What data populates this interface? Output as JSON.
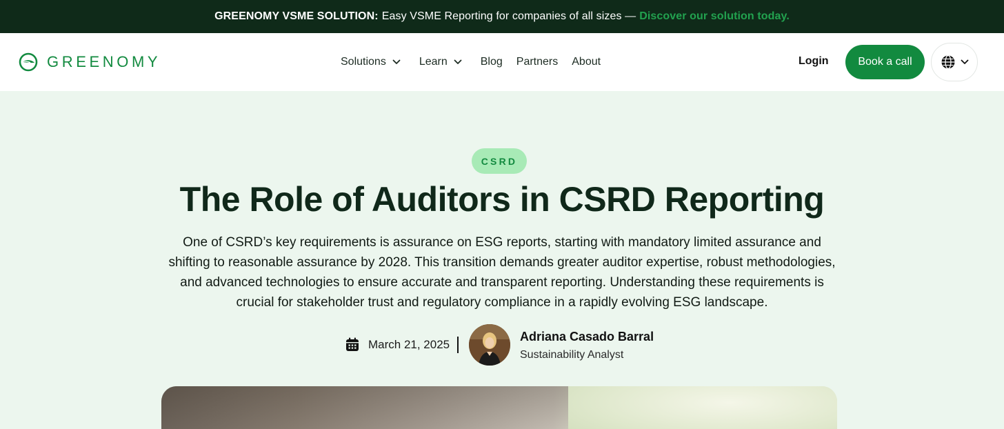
{
  "announcement": {
    "label": "GREENOMY VSME SOLUTION:",
    "message": "Easy VSME Reporting for companies of all sizes —",
    "cta": "Discover our solution today."
  },
  "nav": {
    "brand": "GREENOMY",
    "links": [
      {
        "label": "Solutions",
        "has_dropdown": true
      },
      {
        "label": "Learn",
        "has_dropdown": true
      },
      {
        "label": "Blog",
        "has_dropdown": false
      },
      {
        "label": "Partners",
        "has_dropdown": false
      },
      {
        "label": "About",
        "has_dropdown": false
      }
    ],
    "login": "Login",
    "book_call": "Book a call",
    "language_icon": "globe-icon"
  },
  "article": {
    "category": "CSRD",
    "title": "The Role of Auditors in CSRD Reporting",
    "summary": "One of CSRD’s key requirements is assurance on ESG reports, starting with mandatory limited assurance and shifting to reasonable assurance by 2028. This transition demands greater auditor expertise, robust methodologies, and advanced technologies to ensure accurate and transparent reporting. Understanding these requirements is crucial for stakeholder trust and regulatory compliance in a rapidly evolving ESG landscape.",
    "date": "March 21, 2025",
    "author": {
      "name": "Adriana Casado Barral",
      "role": "Sustainability Analyst"
    }
  },
  "colors": {
    "brand_green": "#128a3f",
    "cta_green": "#22a24f",
    "topbar_bg": "#0f2a19",
    "hero_bg": "#ecf6ee",
    "badge_bg": "#a8eab6"
  }
}
